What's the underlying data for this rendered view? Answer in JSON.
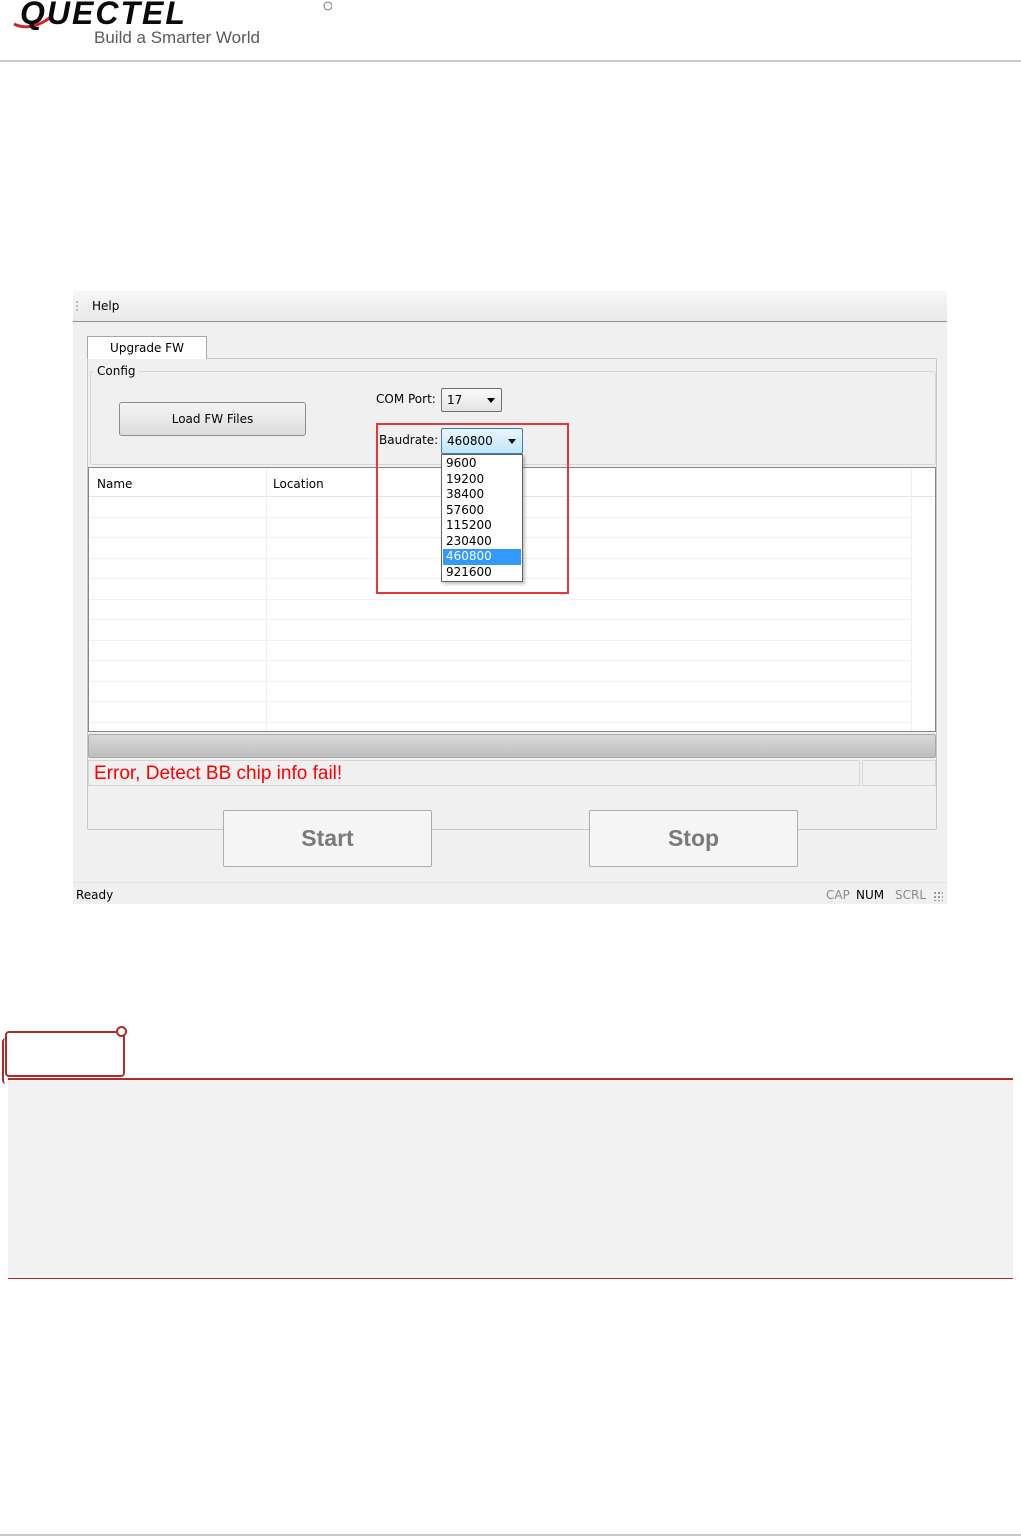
{
  "header": {
    "logo_text": "QUECTEL",
    "tagline": "Build a Smarter World"
  },
  "app": {
    "menu": {
      "help": "Help"
    },
    "tabs": [
      {
        "label": "Upgrade FW"
      }
    ],
    "config": {
      "group_title": "Config",
      "load_button": "Load FW Files",
      "com_port_label": "COM Port:",
      "com_port_value": "17",
      "baudrate_label": "Baudrate:",
      "baudrate_value": "460800",
      "baudrate_options": [
        "9600",
        "19200",
        "38400",
        "57600",
        "115200",
        "230400",
        "460800",
        "921600"
      ],
      "baudrate_selected": "460800"
    },
    "table": {
      "columns": [
        "Name",
        "Location"
      ]
    },
    "error_message": "Error, Detect BB chip info fail!",
    "buttons": {
      "start": "Start",
      "stop": "Stop"
    },
    "statusbar": {
      "ready": "Ready",
      "cap": "CAP",
      "num": "NUM",
      "scrl": "SCRL"
    }
  },
  "colors": {
    "error_text": "#ff0000",
    "highlight_box": "#e8363d",
    "note_accent": "#b02a2a",
    "selected_option": "#3399ff"
  }
}
